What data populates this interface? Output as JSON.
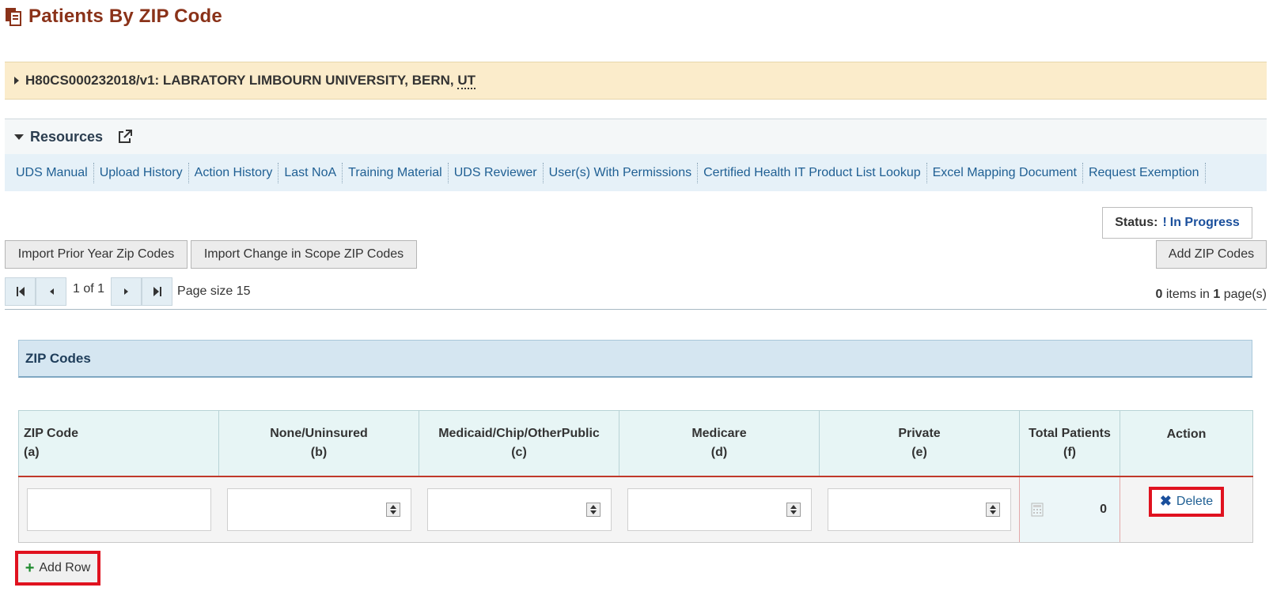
{
  "page": {
    "title": "Patients By ZIP Code"
  },
  "grant": {
    "text": "H80CS000232018/v1: LABRATORY LIMBOURN UNIVERSITY, BERN, ",
    "state_abbr": "UT"
  },
  "resources": {
    "title": "Resources",
    "links": [
      "UDS Manual",
      "Upload History",
      "Action History",
      "Last NoA",
      "Training Material",
      "UDS Reviewer",
      "User(s) With Permissions",
      "Certified Health IT Product List Lookup",
      "Excel Mapping Document",
      "Request Exemption"
    ]
  },
  "status": {
    "label": "Status:",
    "bang": "!",
    "value": "In Progress"
  },
  "toolbar": {
    "import_prior": "Import Prior Year Zip Codes",
    "import_scope": "Import Change in Scope ZIP Codes",
    "add_zip": "Add ZIP Codes"
  },
  "pager": {
    "page_text": "1 of 1",
    "page_size": "Page size 15",
    "items_count": "0",
    "items_mid": " items in ",
    "pages_count": "1",
    "items_suffix": " page(s)"
  },
  "section": {
    "title": "ZIP Codes"
  },
  "table": {
    "columns": [
      {
        "name": "ZIP Code",
        "code": "(a)"
      },
      {
        "name": "None/Uninsured",
        "code": "(b)"
      },
      {
        "name": "Medicaid/Chip/OtherPublic",
        "code": "(c)"
      },
      {
        "name": "Medicare",
        "code": "(d)"
      },
      {
        "name": "Private",
        "code": "(e)"
      },
      {
        "name": "Total Patients",
        "code": "(f)"
      },
      {
        "name": "Action",
        "code": ""
      }
    ],
    "row": {
      "zip": "",
      "none": "",
      "medicaid": "",
      "medicare": "",
      "private": "",
      "total": "0",
      "delete_label": "Delete"
    }
  },
  "add_row_label": "Add Row"
}
